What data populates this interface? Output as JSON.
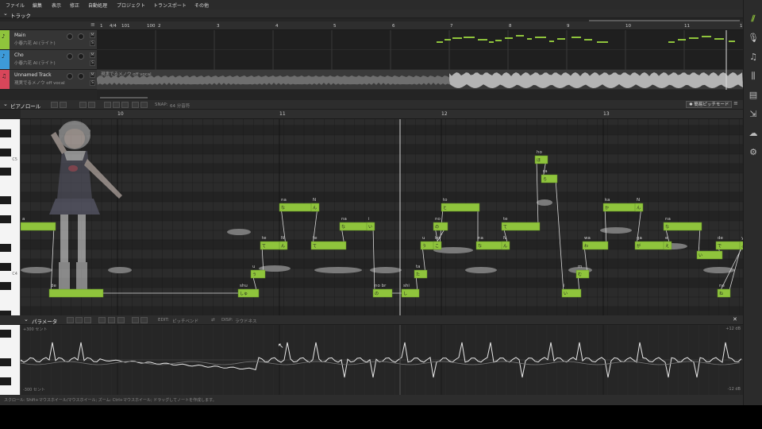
{
  "menu": [
    "ファイル",
    "編集",
    "表示",
    "修正",
    "自動処理",
    "プロジェクト",
    "トランスポート",
    "その他"
  ],
  "tracks_section": {
    "title": "トラック",
    "ruler": {
      "time_sig": "4/4",
      "tempo": "101",
      "zoom": "100",
      "bars": [
        "1",
        "2",
        "3",
        "4",
        "5",
        "6",
        "7",
        "8",
        "9",
        "10",
        "11",
        "1"
      ]
    },
    "tracks": [
      {
        "name": "Main",
        "singer": "小春六花 AI (ライト)",
        "color": "#8fc43c",
        "mute": "M",
        "solo": "S"
      },
      {
        "name": "Cho",
        "singer": "小春六花 AI (ライト)",
        "color": "#3d9ad8",
        "mute": "M",
        "solo": "S"
      },
      {
        "name": "Unnamed Track",
        "singer": "現実でるメノウ off vocal",
        "color": "#d8465a",
        "mute": "M",
        "solo": "S",
        "clip_label": "現実でるメノウ off vocal"
      }
    ]
  },
  "piano_roll": {
    "title": "ピアノロール",
    "snap_label": "SNAP:",
    "snap_value": "64 分音符",
    "pitch_mode": "✱ 簡易ピッチモード",
    "bars": [
      "10",
      "11",
      "12",
      "13"
    ],
    "octave_labels": [
      "C5",
      "C4"
    ],
    "notes": [
      {
        "syl": "a",
        "text": ""
      },
      {
        "syl": "de",
        "text": ""
      },
      {
        "syl": "shu",
        "text": "しゅ"
      },
      {
        "syl": "u",
        "text": "う"
      },
      {
        "syl": "te",
        "text": "て"
      },
      {
        "syl": "N",
        "text": "ん"
      },
      {
        "syl": "na",
        "text": "な"
      },
      {
        "syl": "N",
        "text": "ん"
      },
      {
        "syl": "te",
        "text": "て"
      },
      {
        "syl": "na",
        "text": "な"
      },
      {
        "syl": "i",
        "text": "い"
      },
      {
        "syl": "no br",
        "text": "の"
      },
      {
        "syl": "shi",
        "text": "し"
      },
      {
        "syl": "ta",
        "text": "た"
      },
      {
        "syl": "u",
        "text": "う"
      },
      {
        "syl": "no",
        "text": "の"
      },
      {
        "syl": "ko",
        "text": "こ"
      },
      {
        "syl": "to",
        "text": "と"
      },
      {
        "syl": "na",
        "text": "な"
      },
      {
        "syl": "N",
        "text": "ん"
      },
      {
        "syl": "te",
        "text": "て"
      },
      {
        "syl": "ho",
        "text": "ほ"
      },
      {
        "syl": "ra",
        "text": "ら"
      },
      {
        "syl": "i",
        "text": "い"
      },
      {
        "syl": "m",
        "text": "む"
      },
      {
        "syl": "wa",
        "text": "わ"
      },
      {
        "syl": "ka",
        "text": "か"
      },
      {
        "syl": "N",
        "text": "ん"
      },
      {
        "syl": "ga",
        "text": "が"
      },
      {
        "syl": "e",
        "text": "え"
      },
      {
        "syl": "na",
        "text": "な"
      },
      {
        "syl": "i",
        "text": "い"
      },
      {
        "syl": "de",
        "text": "で"
      },
      {
        "syl": "ne",
        "text": "ね"
      },
      {
        "syl": "yo",
        "text": "よ"
      }
    ]
  },
  "parameters": {
    "title": "パラメータ",
    "edit_label": "EDIT:",
    "edit_value": "ピッチベンド",
    "disp_label": "DISP:",
    "disp_value": "ラウドネス",
    "top_left": "+300 セント",
    "bottom_left": "-300 セント",
    "top_right": "+12 dB",
    "bottom_right": "-12 dB",
    "close": "✕"
  },
  "status_text": "スクロール: Shift+マウスホイール/マウスホイール; ズーム: Ctrl+マウスホイール; ドラッグしてノートを作成します。",
  "right_toolbar": [
    "logo-icon",
    "mic-icon",
    "music-note-icon",
    "library-icon",
    "document-icon",
    "export-icon",
    "cloud-icon",
    "gear-icon"
  ],
  "colors": {
    "note": "#8fc43c",
    "main": "#8fc43c",
    "cho": "#3d9ad8",
    "unnamed": "#d8465a"
  }
}
